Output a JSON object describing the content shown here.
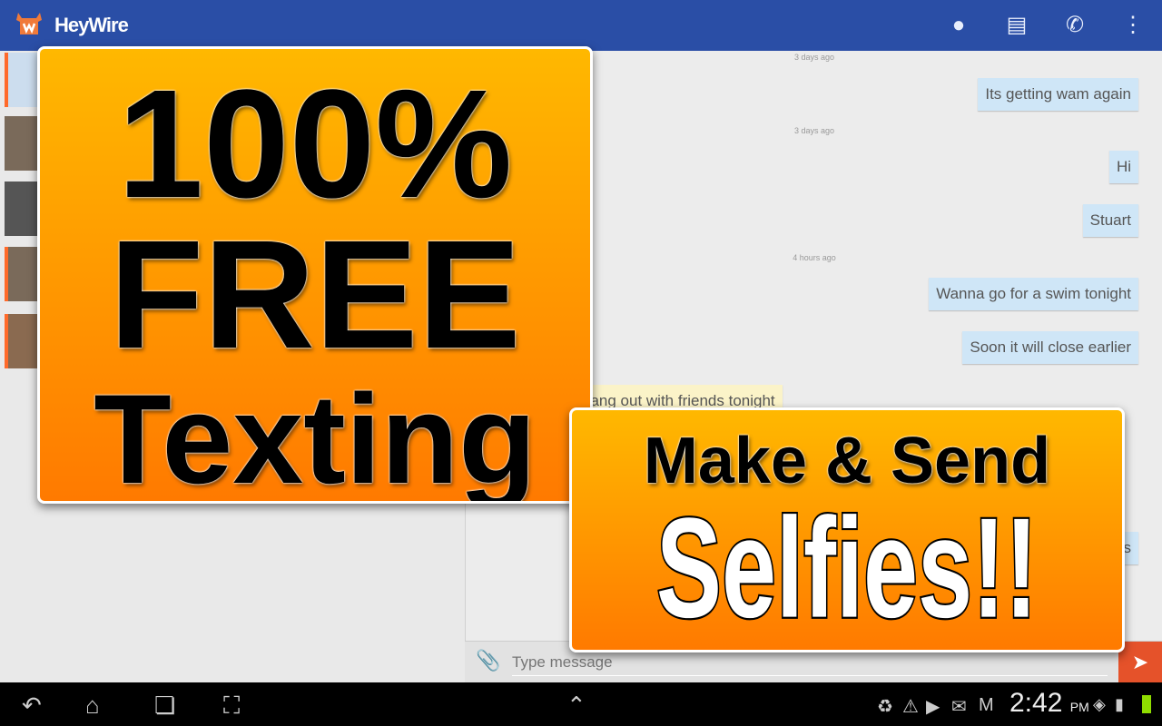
{
  "app": {
    "title": "HeyWire"
  },
  "toolbar": {
    "icons": [
      "contact-icon",
      "new-message-icon",
      "phone-icon",
      "overflow-menu-icon"
    ]
  },
  "contacts": [
    {
      "type": "twitter"
    },
    {
      "type": "photo"
    },
    {
      "type": "photo"
    },
    {
      "type": "photo"
    },
    {
      "type": "photo"
    }
  ],
  "messages": [
    {
      "timestamp": "3 days ago"
    },
    {
      "text": "Its getting wam again",
      "dir": "out"
    },
    {
      "timestamp": "3 days ago"
    },
    {
      "text": "Hi",
      "dir": "out"
    },
    {
      "text": "Stuart",
      "dir": "out"
    },
    {
      "timestamp": "4 hours ago"
    },
    {
      "text": "Wanna go for a swim tonight",
      "dir": "out"
    },
    {
      "text": "Soon it will close earlier",
      "dir": "out"
    },
    {
      "text": "hang out with friends tonight",
      "dir": "in"
    },
    {
      "text": "es",
      "dir": "out"
    }
  ],
  "composer": {
    "placeholder": "Type message"
  },
  "promo1": {
    "line1": "100%",
    "line2": "FREE",
    "line3": "Texting"
  },
  "promo2": {
    "line1": "Make & Send",
    "line2": "Selfies!!"
  },
  "statusbar": {
    "time": "2:42",
    "ampm": "PM",
    "battery_color": "#8fdc00"
  },
  "colors": {
    "topbar": "#2a4ea6",
    "accent": "#e5522a",
    "bubble_out": "#cfe6f7",
    "bubble_in": "#fbf3c8"
  }
}
